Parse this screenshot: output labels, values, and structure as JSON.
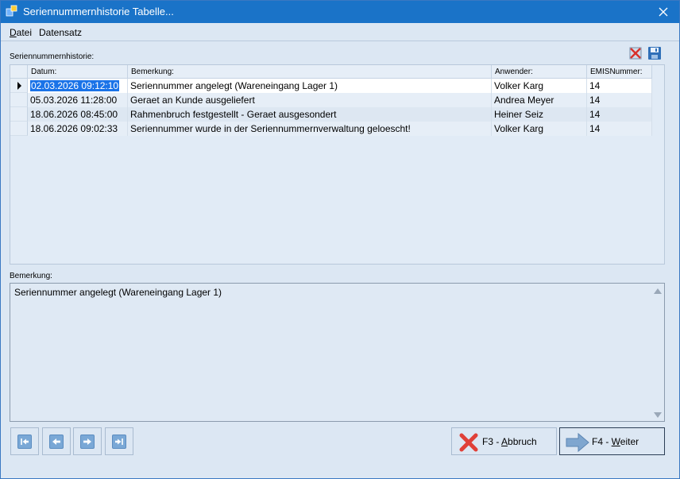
{
  "window": {
    "title": "Seriennummernhistorie Tabelle..."
  },
  "menu": {
    "items": [
      {
        "pre": "",
        "ul": "D",
        "post": "atei"
      },
      {
        "pre": "Datensatz",
        "ul": "",
        "post": ""
      }
    ]
  },
  "history": {
    "label": "Seriennummernhistorie:",
    "columns": [
      "Datum:",
      "Bemerkung:",
      "Anwender:",
      "EMISNummer:"
    ],
    "rows": [
      {
        "datum": "02.03.2026 09:12:10",
        "bemerkung": "Seriennummer angelegt (Wareneingang Lager 1)",
        "anwender": "Volker Karg",
        "emis": "14"
      },
      {
        "datum": "05.03.2026 11:28:00",
        "bemerkung": "Geraet an Kunde ausgeliefert",
        "anwender": "Andrea Meyer",
        "emis": "14"
      },
      {
        "datum": "18.06.2026 08:45:00",
        "bemerkung": "Rahmenbruch festgestellt - Geraet ausgesondert",
        "anwender": "Heiner Seiz",
        "emis": "14"
      },
      {
        "datum": "18.06.2026 09:02:33",
        "bemerkung": "Seriennummer wurde in der Seriennummernverwaltung geloescht!",
        "anwender": "Volker Karg",
        "emis": "14"
      }
    ],
    "selected_row": 0
  },
  "remark": {
    "label": "Bemerkung:",
    "text": "Seriennummer angelegt (Wareneingang Lager 1)"
  },
  "buttons": {
    "cancel": {
      "pre": "F3 - ",
      "ul": "A",
      "post": "bbruch"
    },
    "next": {
      "pre": "F4 - ",
      "ul": "W",
      "post": "eiter"
    }
  },
  "nav": [
    "first-record",
    "previous-record",
    "next-record",
    "last-record"
  ],
  "colors": {
    "titlebar": "#1a73c8",
    "window_bg": "#dce7f3",
    "selection": "#1a73e8"
  }
}
